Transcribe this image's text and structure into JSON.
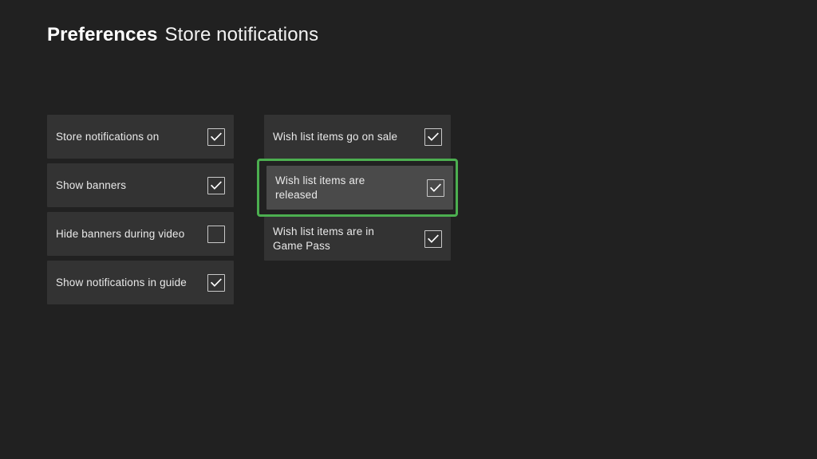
{
  "header": {
    "title": "Preferences",
    "subtitle": "Store notifications"
  },
  "theme": {
    "page_background": "#212121",
    "row_background": "#333333",
    "focused_row_background": "#4a4a4a",
    "focus_accent": "#4caf50",
    "text_color": "#e9e9e9",
    "checkbox_border": "#c9c9c9"
  },
  "columns": [
    {
      "name": "left-column",
      "items": [
        {
          "label": "Store notifications on",
          "checked": true,
          "focused": false
        },
        {
          "label": "Show banners",
          "checked": true,
          "focused": false
        },
        {
          "label": "Hide banners during video",
          "checked": false,
          "focused": false
        },
        {
          "label": "Show notifications in guide",
          "checked": true,
          "focused": false
        }
      ]
    },
    {
      "name": "right-column",
      "items": [
        {
          "label": "Wish list items go on sale",
          "checked": true,
          "focused": false
        },
        {
          "label": "Wish list items are released",
          "checked": true,
          "focused": true
        },
        {
          "label": "Wish list items are in Game Pass",
          "checked": true,
          "focused": false
        }
      ]
    }
  ],
  "icons": {
    "checkmark": "check-icon"
  }
}
